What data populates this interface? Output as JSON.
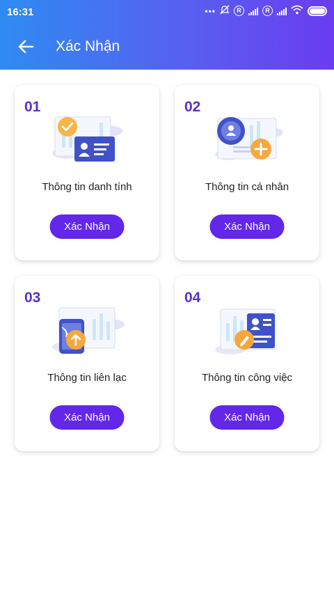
{
  "status_bar": {
    "time": "16:31",
    "icons": [
      "more-dots-icon",
      "mute-icon",
      "roaming-r-icon",
      "signal-icon",
      "roaming-r-icon",
      "signal-icon",
      "wifi-icon",
      "battery-icon"
    ],
    "roaming_label": "R"
  },
  "header": {
    "title": "Xác Nhận",
    "back_icon": "back-arrow-icon"
  },
  "colors": {
    "header_gradient_start": "#2f8bf2",
    "header_gradient_end": "#6b3cf0",
    "accent": "#6227e8",
    "number": "#5a31c8"
  },
  "cards": [
    {
      "number": "01",
      "label": "Thông tin danh tính",
      "button": "Xác Nhận",
      "icon": "identity-card-icon"
    },
    {
      "number": "02",
      "label": "Thông tin cá nhân",
      "button": "Xác Nhận",
      "icon": "personal-profile-icon"
    },
    {
      "number": "03",
      "label": "Thông tin liên lạc",
      "button": "Xác Nhận",
      "icon": "contact-phone-icon"
    },
    {
      "number": "04",
      "label": "Thông tin công việc",
      "button": "Xác Nhận",
      "icon": "work-document-icon"
    }
  ]
}
